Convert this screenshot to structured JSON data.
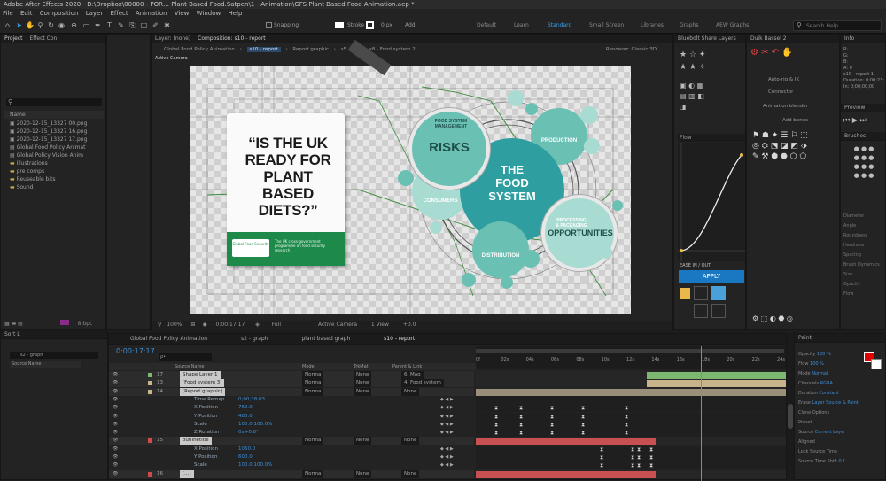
{
  "window": {
    "title": "Adobe After Effects 2020 - D:\\Dropbox\\00000 - POR… Plant Based Food.Satpen\\1 - Animation\\GFS Plant Based Food Animation.aep *"
  },
  "menu": [
    "File",
    "Edit",
    "Composition",
    "Layer",
    "Effect",
    "Animation",
    "View",
    "Window",
    "Help"
  ],
  "toolbar": {
    "snapping_label": "Snapping",
    "stroke_label": "Stroke",
    "px_label": "0 px",
    "add_label": "Add:",
    "workspaces": [
      "Default",
      "Learn",
      "Standard",
      "Small Screen",
      "Libraries",
      "Graphs",
      "AEW Graphs"
    ],
    "active_workspace": "Standard",
    "search_placeholder": "Search Help"
  },
  "project_panel": {
    "tabs": [
      "Project",
      "Effect Con"
    ],
    "search_placeholder": "",
    "name_header": "Name",
    "items": [
      "2020-12-15_13327 00.png",
      "2020-12-15_13327 16.png",
      "2020-12-15_13327 17.png",
      "Global Food Policy Animat",
      "Global Policy Vision Anim",
      "Illustrations",
      "pre comps",
      "Reuseable bits",
      "Sound"
    ],
    "bpc": "8 bpc"
  },
  "composition_panel": {
    "header_tabs": [
      "Layer: (none)",
      "Composition: s10 - report"
    ],
    "breadcrumbs": [
      "Global Food Policy Animation",
      "s10 - report",
      "Report graphic",
      "s5 - ok",
      "s8 - Food system 2"
    ],
    "renderer": "Renderer: Classic 3D",
    "camera_label": "Active Camera",
    "zoom": "100%",
    "timecode": "0:00:17:17",
    "resolution": "Full",
    "view_count": "1 View",
    "offset": "+0.0",
    "camera_sublabel": "Active Camera"
  },
  "artwork": {
    "book_title": "“IS THE UK\nREADY FOR\nPLANT BASED\nDIETS?”",
    "logo_text": "Global Food Security",
    "blurb": "The UK cross-government programme on food security research",
    "center": "THE\nFOOD\nSYSTEM",
    "risks": "RISKS",
    "opportunities": "OPPORTUNITIES",
    "consumers": "CONSUMERS",
    "distribution": "DISTRIBUTION",
    "production": "PRODUCTION",
    "processing": "PROCESSING\n& PACKAGING",
    "environment": "FOOD SYSTEM\nMANAGEMENT"
  },
  "right_panels": {
    "dock_title": "Duik Bassel 2",
    "info_tab": "Info",
    "info_lines": [
      "R:",
      "G:",
      "B:",
      "A: 0",
      "s10 - report 1",
      "Duration: 0;00;23;13",
      "In: 0;00;00;00"
    ],
    "preview_tab": "Preview",
    "flow_tab": "Flow",
    "layer_tab": "Bluebolt Share Layers",
    "connector_label": "Connector",
    "auto_rig_label": "Auto-rig & IK",
    "anim_blender_label": "Animation blender",
    "add_bones_label": "Add bones",
    "ease_label": "EASE IN / OUT",
    "apply_label": "APPLY",
    "brushes_tab": "Brushes",
    "motion_blur": "Motion Blur",
    "paint_tab": "Paint"
  },
  "timeline": {
    "tabs": [
      "Global Food Policy Animation",
      "s2 - graph",
      "plant based graph",
      "s10 - report"
    ],
    "active_tab": "s10 - report",
    "timecode": "0:00:17:17",
    "search_placeholder": "ρ•",
    "headers": {
      "source_name": "Source Name",
      "mode": "Mode",
      "trkmat": "TrkMat",
      "parent": "Parent & Link"
    },
    "ruler": [
      "0f",
      "02s",
      "04s",
      "06s",
      "08s",
      "10s",
      "12s",
      "14s",
      "16s",
      "18s",
      "20s",
      "22s",
      "24s"
    ],
    "layers": [
      {
        "num": "17",
        "name": "Shape Layer 1",
        "mode": "Norma",
        "trk": "None",
        "parent": "6. Mag",
        "color": "#7db870"
      },
      {
        "num": "13",
        "name": "[Food system 3]",
        "mode": "Norma",
        "trk": "None",
        "parent": "4. Food system",
        "color": "#c8b48a"
      },
      {
        "num": "14",
        "name": "[Report graphic]",
        "mode": "Norma",
        "trk": "None",
        "parent": "None",
        "color": "#c8b48a"
      },
      {
        "num": "",
        "name": "Time Remap",
        "mode": "",
        "trk": "",
        "parent": "",
        "color": "",
        "value": "0;00;18;03"
      },
      {
        "num": "",
        "name": "X Position",
        "mode": "",
        "trk": "",
        "parent": "",
        "color": "",
        "value": "762.0"
      },
      {
        "num": "",
        "name": "Y Position",
        "mode": "",
        "trk": "",
        "parent": "",
        "color": "",
        "value": "480.0"
      },
      {
        "num": "",
        "name": "Scale",
        "mode": "",
        "trk": "",
        "parent": "",
        "color": "",
        "value": "100.0,100.0%"
      },
      {
        "num": "",
        "name": "Z Rotation",
        "mode": "",
        "trk": "",
        "parent": "",
        "color": "",
        "value": "0x+0.0°"
      },
      {
        "num": "15",
        "name": "outlinetitle",
        "mode": "Norma",
        "trk": "None",
        "parent": "None",
        "color": "#d14a4a"
      },
      {
        "num": "",
        "name": "X Position",
        "mode": "",
        "trk": "",
        "parent": "",
        "color": "",
        "value": "1060.0"
      },
      {
        "num": "",
        "name": "Y Position",
        "mode": "",
        "trk": "",
        "parent": "",
        "color": "",
        "value": "600.0"
      },
      {
        "num": "",
        "name": "Scale",
        "mode": "",
        "trk": "",
        "parent": "",
        "color": "",
        "value": "100.0,100.0%"
      },
      {
        "num": "16",
        "name": "[...]",
        "mode": "Norma",
        "trk": "None",
        "parent": "None",
        "color": "#d14a4a"
      }
    ],
    "playhead_percent": 0.726
  },
  "paint_panel": {
    "title": "Paint",
    "labels": [
      "Opacity",
      "Flow",
      "Mode",
      "Channels",
      "Duration",
      "Erase",
      "Clone Options",
      "Preset",
      "Source",
      "Aligned",
      "Lock Source Time",
      "Source Time Shift"
    ],
    "values": [
      "100 %",
      "100 %",
      "Normal",
      "RGBA",
      "Constant",
      "Layer Source & Paint",
      "",
      "",
      "Current Layer",
      "",
      "",
      "0 f"
    ]
  },
  "colors": {
    "accent": "#3aa0e8",
    "teal_dark": "#2e9ea0",
    "teal_mid": "#6bc0b4",
    "teal_light": "#a8dcd2",
    "paint_fg": "#e00000"
  }
}
